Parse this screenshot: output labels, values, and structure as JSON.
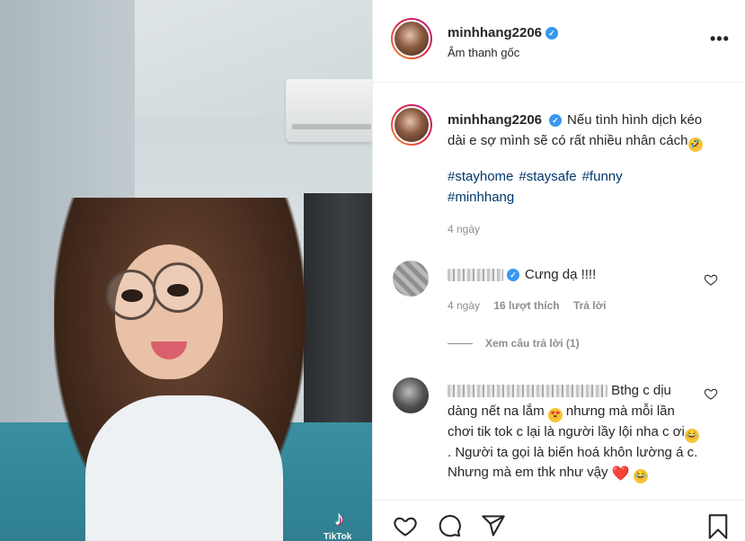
{
  "media": {
    "watermark_text": "TikTok"
  },
  "post": {
    "username": "minhhang2206",
    "audio": "Âm thanh gốc",
    "more_label": "•••",
    "caption": {
      "username": "minhhang2206",
      "text": "Nếu tình hình dịch kéo dài e sợ mình sẽ có rất nhiều nhân cách",
      "emoji": "🤣",
      "hashtags": [
        "#stayhome",
        "#staysafe",
        "#funny",
        "#minhhang"
      ],
      "time": "4 ngày"
    },
    "comments": [
      {
        "text": "Cưng dạ !!!!",
        "time": "4 ngày",
        "likes": "16 lượt thích",
        "reply_label": "Trả lời",
        "view_replies": "Xem câu trả lời (1)"
      },
      {
        "text_parts": [
          "Bthg c dịu dàng nết na lắm",
          "nhưng mà mỗi lần chơi tik tok c lại là người lầy lội nha c ơi",
          ". Người ta gọi là biến hoá khôn lường á c. Nhưng mà em thk như vậy"
        ],
        "emojis": [
          "😍",
          "😂",
          "❤️",
          "😂"
        ]
      }
    ]
  },
  "icons": {
    "like": "heart-icon",
    "comment": "comment-icon",
    "share": "share-icon",
    "save": "bookmark-icon"
  },
  "colors": {
    "verified_badge": "#3897f0",
    "hashtag": "#00376b",
    "secondary_text": "#8e8e8e"
  }
}
